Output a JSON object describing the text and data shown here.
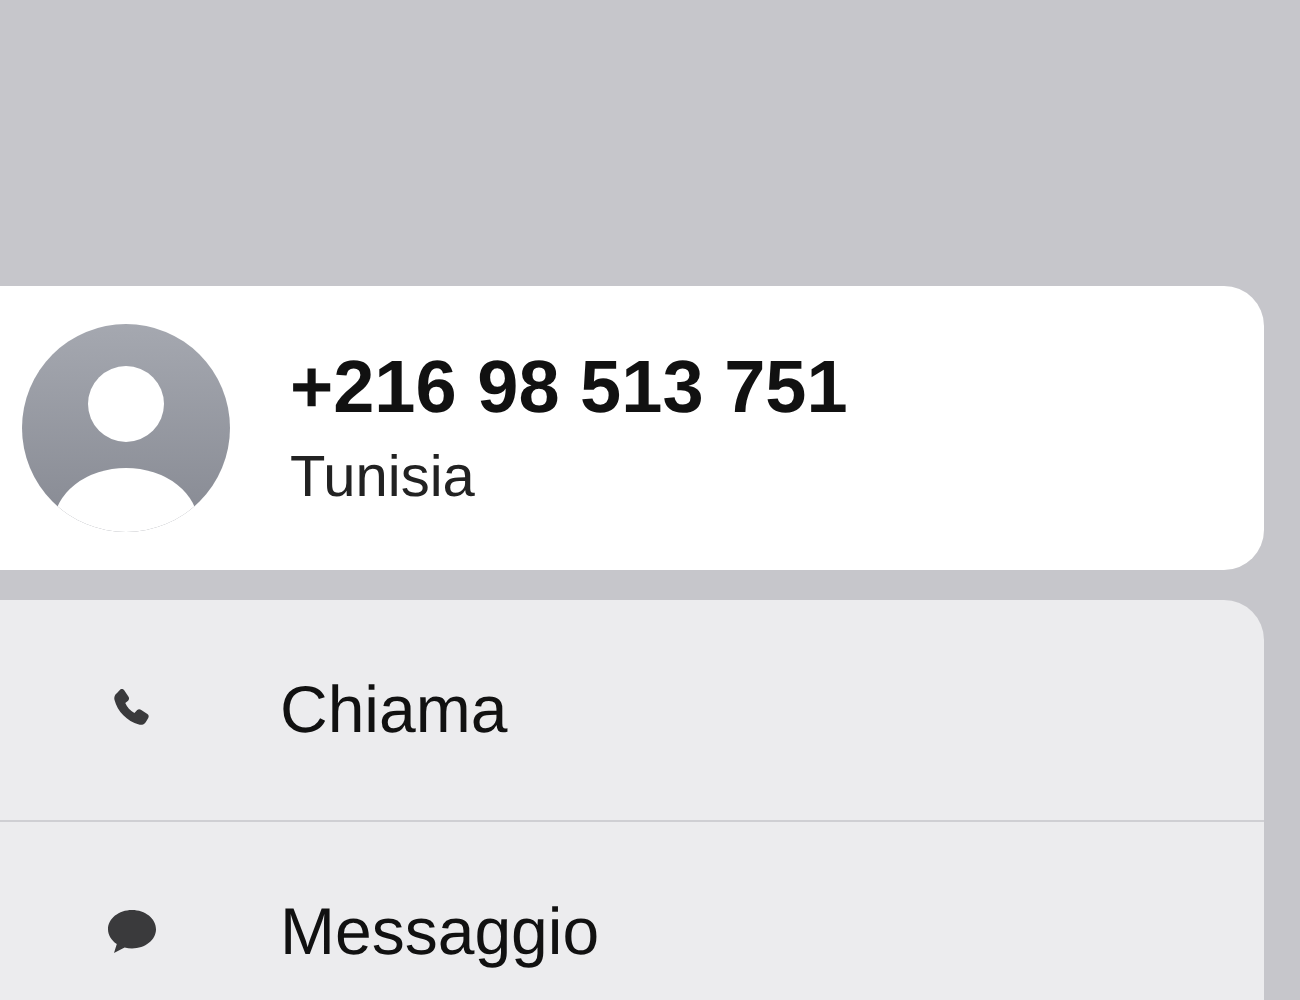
{
  "contact": {
    "phone_number": "+216 98 513 751",
    "subtitle": "Tunisia"
  },
  "actions": [
    {
      "kind": "call",
      "label": "Chiama"
    },
    {
      "kind": "message",
      "label": "Messaggio"
    }
  ]
}
